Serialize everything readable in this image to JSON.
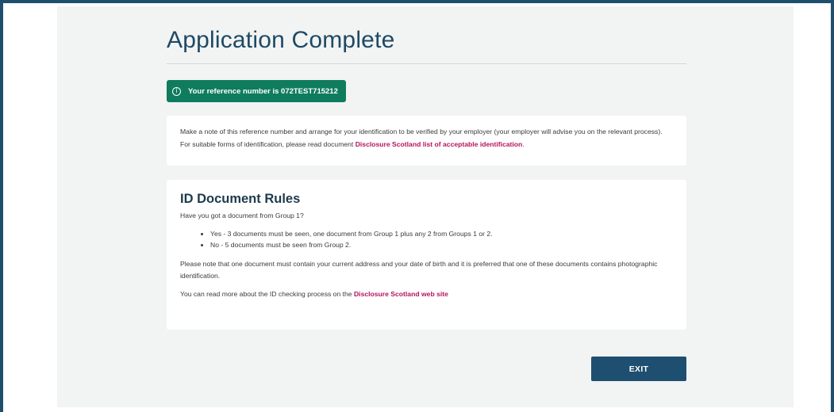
{
  "page": {
    "title": "Application Complete"
  },
  "reference": {
    "icon": "info-circle-icon",
    "text": "Your reference number is 072TEST715212"
  },
  "note": {
    "text": "Make a note of this reference number and arrange for your identification to be verified by your employer (your employer will advise you on the relevant process). For suitable forms of identification, please read document ",
    "link_text": "Disclosure Scotland list of acceptable identification",
    "suffix": "."
  },
  "id_rules": {
    "title": "ID Document Rules",
    "question": "Have you got a document from Group 1?",
    "items": [
      "Yes - 3 documents must be seen, one document from Group 1 plus any 2 from Groups 1 or 2.",
      "No - 5 documents must be seen from Group 2."
    ],
    "note": "Please note that one document must contain your current address and your date of birth and it is preferred that one of these documents contains photographic identification.",
    "more_text": "You can read more about the ID checking process on the ",
    "more_link_text": "Disclosure Scotland web site"
  },
  "actions": {
    "exit_label": "EXIT"
  },
  "colors": {
    "frame_border": "#1f4f6e",
    "panel_background": "#f2f3f3",
    "title": "#1e4a64",
    "reference_badge": "#0f7c5e",
    "link": "#b4135f",
    "exit_button": "#1e4f70"
  }
}
